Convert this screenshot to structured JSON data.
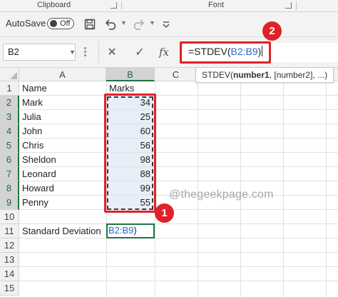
{
  "ribbon": {
    "groups": [
      "Clipboard",
      "Font"
    ]
  },
  "qat": {
    "autosave_label": "AutoSave",
    "autosave_state": "Off",
    "icons": [
      "save-icon",
      "undo-icon",
      "redo-icon",
      "customize-icon"
    ]
  },
  "formula_bar": {
    "name_box": "B2",
    "cancel_glyph": "✕",
    "enter_glyph": "✓",
    "fx_label": "fx",
    "formula_prefix": "=STDEV(",
    "formula_ref": "B2:B9",
    "formula_suffix": ")"
  },
  "tooltip": {
    "fn": "STDEV(",
    "arg1": "number1",
    "rest": ", [number2], ...)"
  },
  "sheet": {
    "columns": [
      "A",
      "B",
      "C"
    ],
    "rows": [
      "1",
      "2",
      "3",
      "4",
      "5",
      "6",
      "7",
      "8",
      "9",
      "10",
      "11",
      "12",
      "13",
      "14",
      "15"
    ],
    "header_name": "Name",
    "header_marks": "Marks",
    "students": [
      {
        "name": "Mark",
        "marks": "34"
      },
      {
        "name": "Julia",
        "marks": "25"
      },
      {
        "name": "John",
        "marks": "60"
      },
      {
        "name": "Chris",
        "marks": "56"
      },
      {
        "name": "Sheldon",
        "marks": "98"
      },
      {
        "name": "Leonard",
        "marks": "88"
      },
      {
        "name": "Howard",
        "marks": "99"
      },
      {
        "name": "Penny",
        "marks": "55"
      }
    ],
    "summary_label": "Standard Deviation",
    "active_cell_ref": "B2:B9",
    "active_cell_suffix": ")"
  },
  "annotations": {
    "badge_1": "1",
    "badge_2": "2",
    "accent_red": "#e02127"
  },
  "watermark": "@thegeekpage.com",
  "colors": {
    "excel_green": "#217346",
    "range_fill": "#e8eef7",
    "ref_blue": "#2e6bc6"
  }
}
